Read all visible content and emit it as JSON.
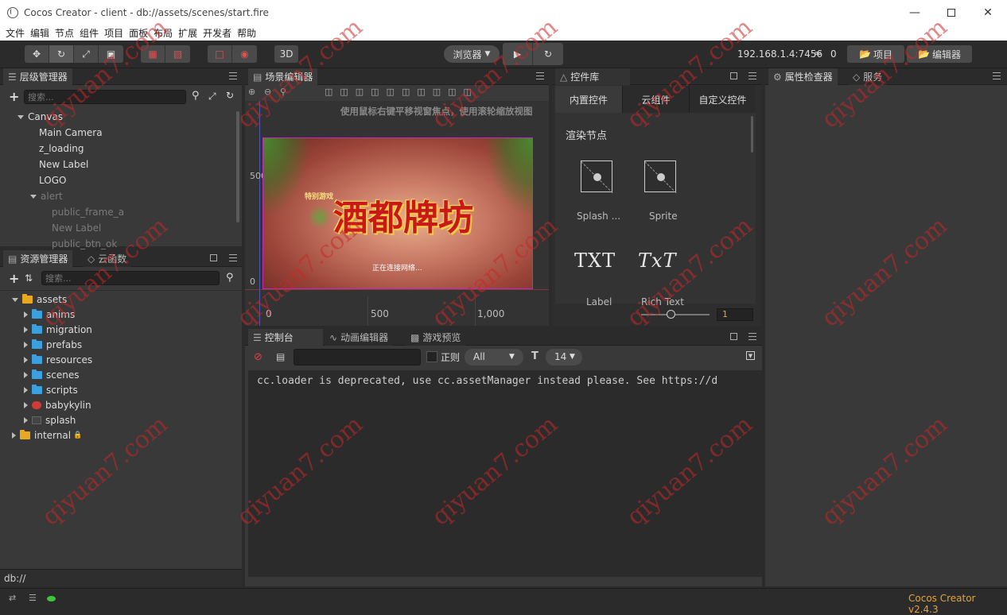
{
  "window": {
    "title": "Cocos Creator - client - db://assets/scenes/start.fire"
  },
  "menu": [
    "文件",
    "编辑",
    "节点",
    "组件",
    "项目",
    "面板",
    "布局",
    "扩展",
    "开发者",
    "帮助"
  ],
  "toolbar": {
    "preview_target": "浏览器",
    "ip": "192.168.1.4:7456",
    "connections": "0",
    "project_btn": "项目",
    "editor_btn": "编辑器",
    "btn_3d": "3D"
  },
  "hierarchy": {
    "tab": "层级管理器",
    "search_placeholder": "搜索...",
    "items": [
      {
        "label": "Canvas",
        "depth": 0,
        "expanded": true
      },
      {
        "label": "Main Camera",
        "depth": 1
      },
      {
        "label": "z_loading",
        "depth": 1
      },
      {
        "label": "New Label",
        "depth": 1
      },
      {
        "label": "LOGO",
        "depth": 1
      },
      {
        "label": "alert",
        "depth": 1,
        "expanded": true,
        "dim": true
      },
      {
        "label": "public_frame_a",
        "depth": 2,
        "dim": true
      },
      {
        "label": "New Label",
        "depth": 2,
        "dim": true
      },
      {
        "label": "public_btn_ok",
        "depth": 2,
        "dim": true
      }
    ]
  },
  "assets": {
    "tab": "资源管理器",
    "tab2": "云函数",
    "search_placeholder": "搜索...",
    "root": "assets",
    "folders": [
      "anims",
      "migration",
      "prefabs",
      "resources",
      "scenes",
      "scripts",
      "babykylin",
      "splash"
    ],
    "internal": "internal",
    "path": "db://"
  },
  "scene": {
    "tab": "场景编辑器",
    "hint": "使用鼠标右键平移视窗焦点，使用滚轮缩放视图",
    "y_labels": [
      "500",
      "0"
    ],
    "x_labels": [
      "0",
      "500",
      "1,000"
    ],
    "game_title": "酒都牌坊",
    "game_subtitle": "特别游戏",
    "loading_text": "正在连接网络..."
  },
  "library": {
    "tab": "控件库",
    "tabs": [
      "内置控件",
      "云组件",
      "自定义控件"
    ],
    "section": "渲染节点",
    "items": [
      {
        "label": "Splash ...",
        "icon": "image-placeholder-icon"
      },
      {
        "label": "Sprite",
        "icon": "image-placeholder-icon"
      },
      {
        "label": "Label",
        "icon": "TXT"
      },
      {
        "label": "Rich Text",
        "icon": "TxT"
      }
    ],
    "zoom_value": "1"
  },
  "console": {
    "tabs": [
      "控制台",
      "动画编辑器",
      "游戏预览"
    ],
    "regex_label": "正则",
    "level": "All",
    "font_size": "14",
    "log": "cc.loader is deprecated, use cc.assetManager instead please. See https://d"
  },
  "inspector": {
    "tab": "属性检查器",
    "tab2": "服务"
  },
  "status": {
    "version": "Cocos Creator v2.4.3"
  },
  "watermark": "qiyuan7.com",
  "colors": {
    "accent": "#e8a820",
    "folder": "#3aa0e0",
    "version": "#e8a03a",
    "selection": "#c02bc0"
  }
}
